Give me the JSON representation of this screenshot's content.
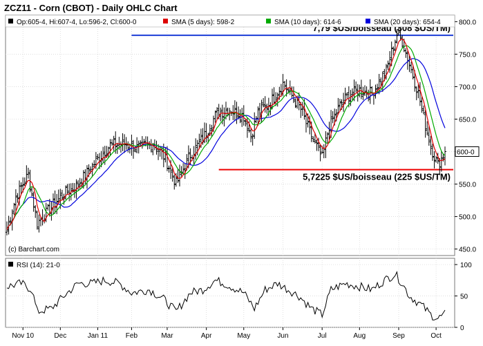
{
  "title": "ZCZ11 - Corn (CBOT) - Daily OHLC Chart",
  "legend": {
    "ohlc": "Op:605-4, Hi:607-4, Lo:596-2, Cl:600-0",
    "sma5": "SMA (5 days): 598-2",
    "sma10": "SMA (10 days): 614-6",
    "sma20": "SMA (20 days): 654-4"
  },
  "rsi_label": "RSI (14): 21-0",
  "credit": "(c) Barchart.com",
  "last_price_label": "600-0",
  "colors": {
    "sma5": "#dd0000",
    "sma10": "#00aa00",
    "sma20": "#0000dd",
    "resistance": "#1a3bd6",
    "support": "#ee0000",
    "price": "#000000"
  },
  "chart_data": {
    "type": "ohlc",
    "price_axis": {
      "ylim": [
        440,
        810
      ],
      "ticks": [
        450,
        500,
        550,
        600,
        650,
        700,
        750,
        800
      ]
    },
    "rsi_axis": {
      "ylim": [
        0,
        110
      ],
      "ticks": [
        0,
        50,
        100
      ]
    },
    "x_tick_labels": [
      "Nov 10",
      "Dec",
      "Jan 11",
      "Feb",
      "Mar",
      "Apr",
      "May",
      "Jun",
      "Jul",
      "Aug",
      "Sep",
      "Oct"
    ],
    "x_tick_index": [
      9,
      30,
      51,
      70,
      90,
      112,
      133,
      155,
      177,
      198,
      220,
      241
    ],
    "annotations": [
      {
        "label": "7,79 $US/boisseau (308 $US/TM)",
        "value": 779,
        "start_index": 70,
        "color": "#1a3bd6",
        "label_side": "above"
      },
      {
        "label": "5,7225 $US/boisseau (225 $US/TM)",
        "value": 572.25,
        "start_index": 119,
        "color": "#ee0000",
        "label_side": "below"
      }
    ],
    "close_anchors": [
      [
        0,
        480
      ],
      [
        5,
        530
      ],
      [
        12,
        565
      ],
      [
        17,
        490
      ],
      [
        22,
        505
      ],
      [
        30,
        530
      ],
      [
        40,
        550
      ],
      [
        50,
        585
      ],
      [
        58,
        610
      ],
      [
        66,
        612
      ],
      [
        74,
        605
      ],
      [
        82,
        612
      ],
      [
        89,
        590
      ],
      [
        95,
        550
      ],
      [
        103,
        595
      ],
      [
        110,
        620
      ],
      [
        118,
        660
      ],
      [
        125,
        665
      ],
      [
        133,
        655
      ],
      [
        137,
        625
      ],
      [
        141,
        660
      ],
      [
        148,
        675
      ],
      [
        155,
        705
      ],
      [
        159,
        690
      ],
      [
        165,
        665
      ],
      [
        170,
        630
      ],
      [
        177,
        590
      ],
      [
        181,
        640
      ],
      [
        189,
        680
      ],
      [
        197,
        695
      ],
      [
        205,
        690
      ],
      [
        213,
        725
      ],
      [
        219,
        780
      ],
      [
        222,
        770
      ],
      [
        226,
        735
      ],
      [
        231,
        690
      ],
      [
        235,
        640
      ],
      [
        239,
        600
      ],
      [
        242,
        580
      ],
      [
        246,
        600
      ]
    ],
    "rsi_anchors": [
      [
        0,
        65
      ],
      [
        8,
        70
      ],
      [
        14,
        60
      ],
      [
        17,
        25
      ],
      [
        25,
        30
      ],
      [
        32,
        50
      ],
      [
        40,
        70
      ],
      [
        48,
        70
      ],
      [
        55,
        75
      ],
      [
        63,
        70
      ],
      [
        70,
        55
      ],
      [
        80,
        60
      ],
      [
        88,
        45
      ],
      [
        95,
        25
      ],
      [
        103,
        55
      ],
      [
        110,
        60
      ],
      [
        117,
        75
      ],
      [
        122,
        70
      ],
      [
        133,
        55
      ],
      [
        139,
        30
      ],
      [
        145,
        60
      ],
      [
        152,
        70
      ],
      [
        158,
        60
      ],
      [
        164,
        50
      ],
      [
        171,
        30
      ],
      [
        177,
        20
      ],
      [
        182,
        60
      ],
      [
        190,
        70
      ],
      [
        198,
        65
      ],
      [
        205,
        60
      ],
      [
        212,
        75
      ],
      [
        218,
        85
      ],
      [
        222,
        70
      ],
      [
        226,
        50
      ],
      [
        233,
        35
      ],
      [
        238,
        20
      ],
      [
        242,
        14
      ],
      [
        246,
        21
      ]
    ],
    "last_index": 246,
    "last_close": 600
  }
}
